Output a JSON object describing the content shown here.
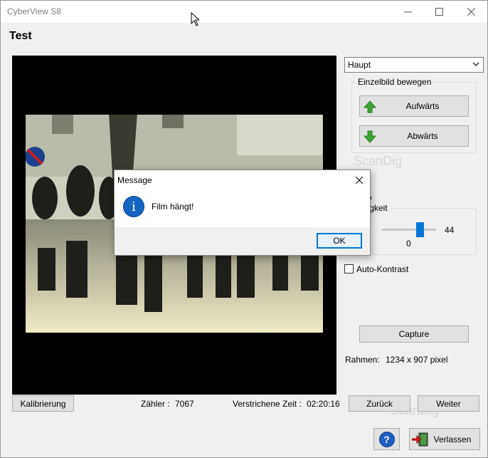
{
  "window": {
    "title": "CyberView S8"
  },
  "header": {
    "title": "Test"
  },
  "right_panel": {
    "mode_select": {
      "value": "Haupt"
    },
    "frame_group": {
      "label": "Einzelbild bewegen",
      "up_button": "Aufwärts",
      "down_button": "Abwärts"
    },
    "brightness_group": {
      "label": "ligkeit",
      "value": "44",
      "zero_label": "0",
      "left_fragment": "r",
      "slider_level": 44
    },
    "section_fragment": "p",
    "auto_contrast": {
      "label": "Auto-Kontrast",
      "checked": false
    },
    "capture_button": "Capture",
    "frame_info": {
      "label": "Rahmen:",
      "value": "1234 x 907 pixel"
    }
  },
  "bottom_bar": {
    "calibrate_button": "Kalibrierung",
    "counter_label": "Zähler :",
    "counter_value": "7067",
    "elapsed_label": "Verstrichene Zeit :",
    "elapsed_value": "02:20:16",
    "back_button": "Zurück",
    "next_button": "Weiter"
  },
  "footer": {
    "help_button": "?",
    "exit_button": "Verlassen"
  },
  "watermark": "ScanDig",
  "dialog": {
    "title": "Message",
    "message": "Film hängt!",
    "ok_button": "OK",
    "icon": "info-icon"
  },
  "colors": {
    "accent": "#0078d7",
    "arrow_up": "#3fa535",
    "arrow_down": "#3fa535",
    "exit_arrow": "#e02020"
  }
}
